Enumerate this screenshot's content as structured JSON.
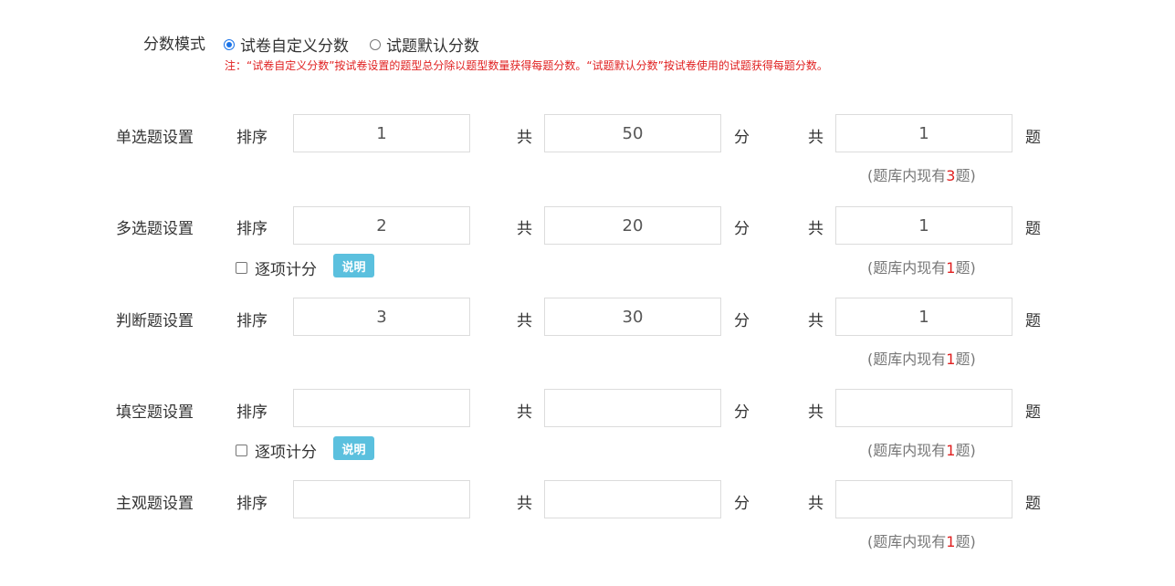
{
  "score_mode": {
    "label": "分数模式",
    "option_custom": "试卷自定义分数",
    "option_default": "试题默认分数",
    "selected": "custom",
    "note": "注：“试卷自定义分数”按试卷设置的题型总分除以题型数量获得每题分数。“试题默认分数”按试卷使用的试题获得每题分数。"
  },
  "labels": {
    "sort": "排序",
    "total": "共",
    "score_unit": "分",
    "count_unit": "题",
    "per_item": "逐项计分",
    "explain": "说明",
    "avail_prefix": "(题库内现有",
    "avail_suffix": "题)"
  },
  "rows": [
    {
      "title": "单选题设置",
      "sort": "1",
      "score": "50",
      "count": "1",
      "available": "3",
      "per_item_option": false
    },
    {
      "title": "多选题设置",
      "sort": "2",
      "score": "20",
      "count": "1",
      "available": "1",
      "per_item_option": true,
      "per_item_checked": false
    },
    {
      "title": "判断题设置",
      "sort": "3",
      "score": "30",
      "count": "1",
      "available": "1",
      "per_item_option": false
    },
    {
      "title": "填空题设置",
      "sort": "",
      "score": "",
      "count": "",
      "available": "1",
      "per_item_option": true,
      "per_item_checked": false
    },
    {
      "title": "主观题设置",
      "sort": "",
      "score": "",
      "count": "",
      "available": "1",
      "per_item_option": false
    }
  ]
}
